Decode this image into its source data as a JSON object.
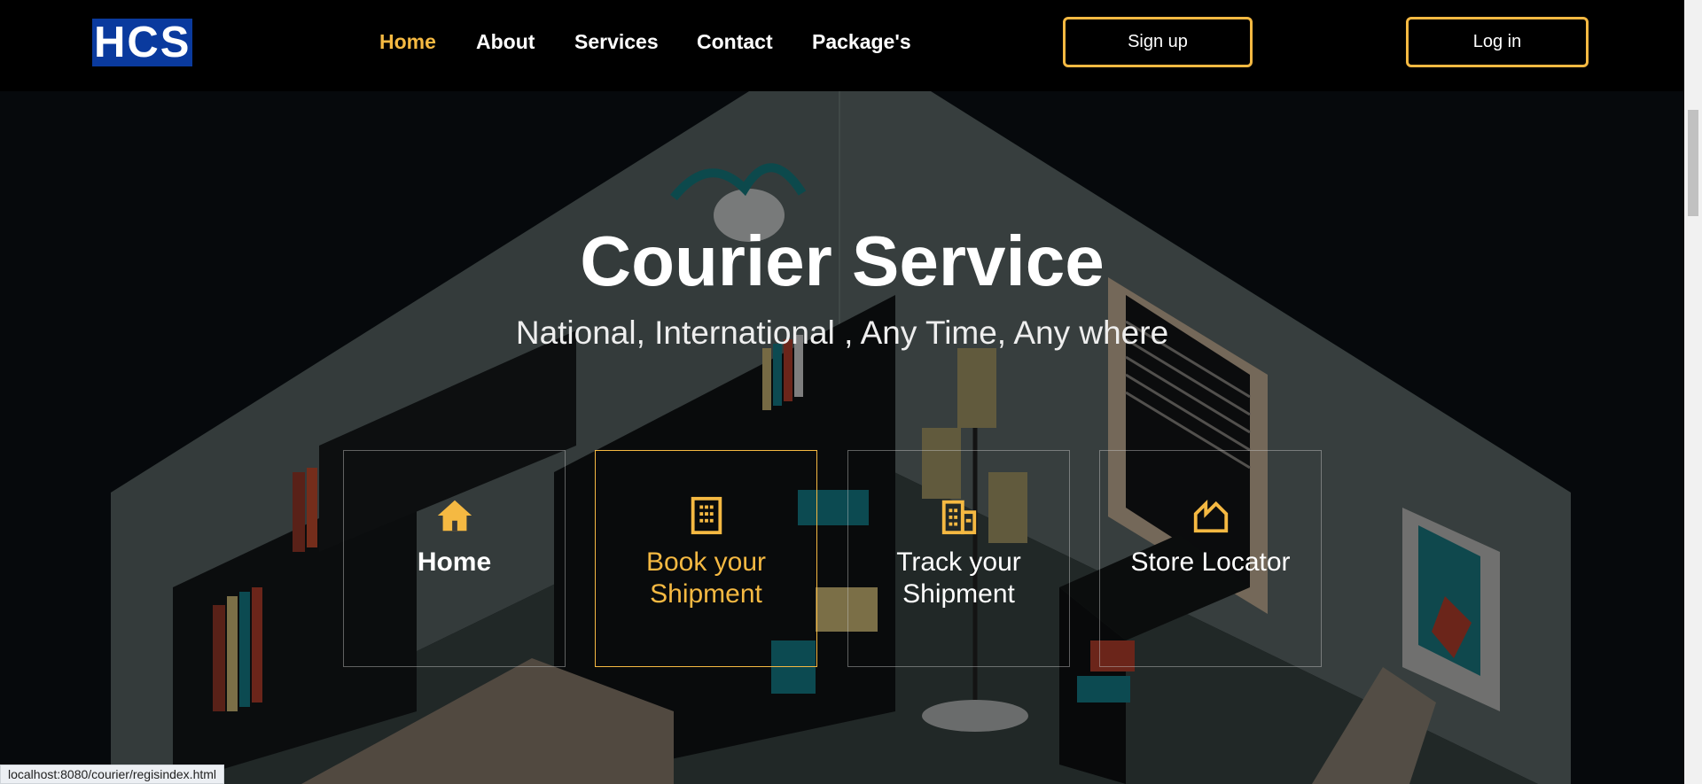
{
  "brand": {
    "logo_text": "HCS"
  },
  "nav": {
    "links": [
      "Home",
      "About",
      "Services",
      "Contact",
      "Package's"
    ],
    "active": "Home",
    "signup_label": "Sign up",
    "login_label": "Log in"
  },
  "hero": {
    "title": "Courier Service",
    "subtitle": "National, International , Any Time, Any where"
  },
  "cards": [
    {
      "label": "Home",
      "icon": "house-icon"
    },
    {
      "label": "Book your Shipment",
      "icon": "building-icon"
    },
    {
      "label": "Track your Shipment",
      "icon": "office-building-icon"
    },
    {
      "label": "Store Locator",
      "icon": "factory-icon"
    }
  ],
  "status_bar": {
    "url": "localhost:8080/courier/regisindex.html"
  },
  "colors": {
    "accent": "#f5b942",
    "navbar": "#000000",
    "logo_bg": "#0a3a9e"
  }
}
